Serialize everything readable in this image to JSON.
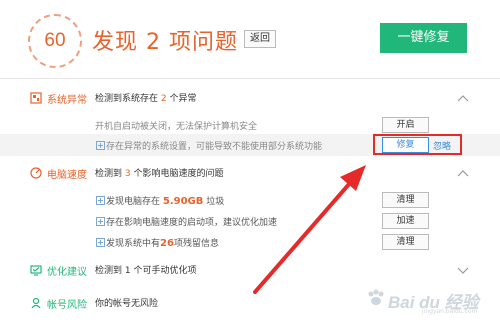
{
  "header": {
    "score": "60",
    "title": "发现 2 项问题",
    "back_label": "返回",
    "fix_all_label": "一键修复"
  },
  "sections": {
    "system": {
      "name": "系统异常",
      "desc_prefix": "检测到系统存在 ",
      "desc_count": "2",
      "desc_suffix": " 个异常",
      "rows": [
        {
          "text": "开机自启动被关闭，无法保护计算机安全",
          "button": "开启"
        },
        {
          "text": "存在异常的系统设置，可能导致不能使用部分系统功能",
          "button": "修复",
          "link": "忽略"
        }
      ]
    },
    "speed": {
      "name": "电脑速度",
      "desc_prefix": "检测到 ",
      "desc_count": "3",
      "desc_suffix": " 个影响电脑速度的问题",
      "rows": [
        {
          "text_prefix": "发现电脑存在 ",
          "text_value": "5.90GB",
          "text_suffix": " 垃圾",
          "button": "清理"
        },
        {
          "text": "存在影响电脑速度的启动项，建议优化加速",
          "button": "加速"
        },
        {
          "text_prefix": "发现系统中有",
          "text_value": "26",
          "text_suffix": "项残留信息",
          "button": "清理"
        }
      ]
    },
    "optimize": {
      "name": "优化建议",
      "desc": "检测到 1 个可手动优化项"
    },
    "account": {
      "name": "帐号风险",
      "desc": "你的帐号无风险"
    }
  },
  "watermark": {
    "text": "Bai du 经验",
    "sub": "jingyan.baidu.com"
  },
  "colors": {
    "accent": "#e8632c",
    "green": "#22b77a",
    "blue": "#3b8de0",
    "annotation_red": "#e52a2a"
  }
}
